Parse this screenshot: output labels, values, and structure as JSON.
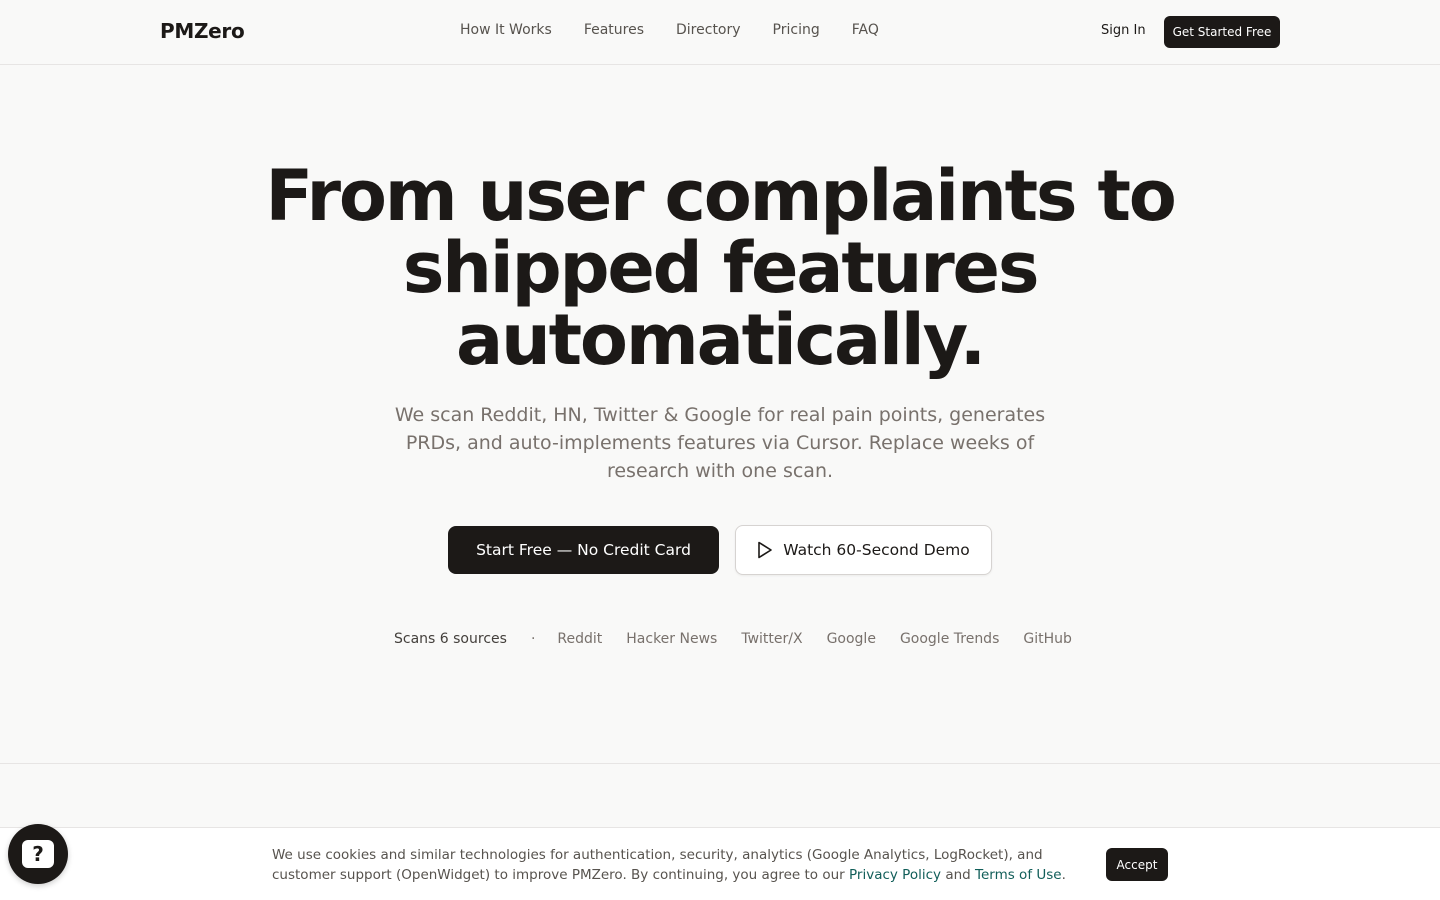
{
  "nav": {
    "brand": "PMZero",
    "links": [
      "How It Works",
      "Features",
      "Directory",
      "Pricing",
      "FAQ"
    ],
    "sign_in": "Sign In",
    "cta": "Get Started Free"
  },
  "hero": {
    "title_line1": "From user complaints to",
    "title_line2": "shipped features",
    "title_line3": "automatically.",
    "subtitle": "We scan Reddit, HN, Twitter & Google for real pain points, generates PRDs, and auto-implements features via Cursor. Replace weeks of research with one scan.",
    "primary_button": "Start Free — No Credit Card",
    "secondary_button": "Watch 60-Second Demo"
  },
  "sources": {
    "lead": "Scans 6 sources",
    "separator": "·",
    "items": [
      "Reddit",
      "Hacker News",
      "Twitter/X",
      "Google",
      "Google Trends",
      "GitHub"
    ]
  },
  "cookie": {
    "text_before": "We use cookies and similar technologies for authentication, security, analytics (Google Analytics, LogRocket), and customer support (OpenWidget) to improve PMZero. By continuing, you agree to our ",
    "privacy_link": "Privacy Policy",
    "and": " and ",
    "terms_link": "Terms of Use",
    "period": ".",
    "accept": "Accept"
  },
  "help_widget": {
    "glyph": "?",
    "icon": "help-question-icon"
  },
  "colors": {
    "background": "#f9f9f8",
    "primary": "#1c1917",
    "link": "#115e59"
  }
}
